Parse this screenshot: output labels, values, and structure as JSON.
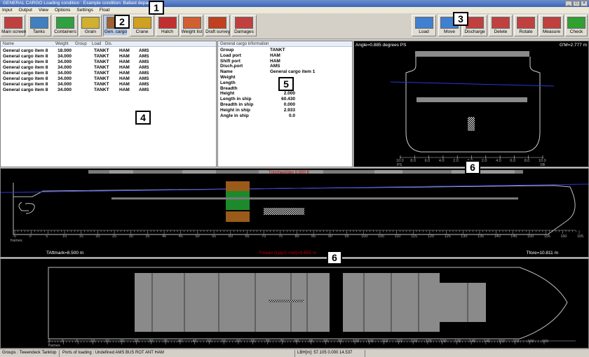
{
  "window": {
    "title": "GENERAL CARGO  Loading condition : Example condition: Ballast departure"
  },
  "menu": [
    "Input",
    "Output",
    "View",
    "Options",
    "Settings",
    "Float"
  ],
  "toolbar_left": [
    {
      "label": "Main screen",
      "icon": "ship-icon",
      "color": "#c04040"
    },
    {
      "label": "Tanks",
      "icon": "tanks-icon",
      "color": "#4080c0"
    },
    {
      "label": "Containers",
      "icon": "containers-icon",
      "color": "#30a040"
    },
    {
      "label": "Grain",
      "icon": "grain-icon",
      "color": "#d0b030"
    },
    {
      "label": "Gen. cargo",
      "icon": "gen-cargo-icon",
      "color": "#a06030"
    },
    {
      "label": "Crane",
      "icon": "crane-icon",
      "color": "#d0a020"
    },
    {
      "label": "Hatch",
      "icon": "hatch-icon",
      "color": "#c03030"
    },
    {
      "label": "Weight list",
      "icon": "weight-list-icon",
      "color": "#d06030"
    },
    {
      "label": "Draft survey",
      "icon": "draft-survey-icon",
      "color": "#c04020"
    },
    {
      "label": "Damages",
      "icon": "damages-icon",
      "color": "#c04040"
    }
  ],
  "toolbar_right": [
    {
      "label": "Load",
      "icon": "load-icon",
      "color": "#4080d0"
    },
    {
      "label": "Move",
      "icon": "move-icon",
      "color": "#4080d0"
    },
    {
      "label": "Discharge",
      "icon": "discharge-icon",
      "color": "#c04040"
    },
    {
      "label": "Delete",
      "icon": "delete-icon",
      "color": "#c04040"
    },
    {
      "label": "Rotate",
      "icon": "rotate-icon",
      "color": "#c04040"
    },
    {
      "label": "Measure",
      "icon": "measure-icon",
      "color": "#c04040"
    },
    {
      "label": "Check",
      "icon": "check-icon",
      "color": "#30a030"
    }
  ],
  "cargo_list": {
    "headers": [
      "Name",
      "Weight",
      "Group",
      "Load",
      "Dis."
    ],
    "rows": [
      [
        "General cargo item 8",
        "18.000",
        "TANKT",
        "HAM",
        "AMS"
      ],
      [
        "General cargo item 8",
        "34.000",
        "TANKT",
        "HAM",
        "AMS"
      ],
      [
        "General cargo item 8",
        "34.000",
        "TANKT",
        "HAM",
        "AMS"
      ],
      [
        "General cargo item 8",
        "34.000",
        "TANKT",
        "HAM",
        "AMS"
      ],
      [
        "General cargo item 8",
        "34.000",
        "TANKT",
        "HAM",
        "AMS"
      ],
      [
        "General cargo item 8",
        "34.000",
        "TANKT",
        "HAM",
        "AMS"
      ],
      [
        "General cargo item 8",
        "34.000",
        "TANKT",
        "HAM",
        "AMS"
      ],
      [
        "General cargo item 8",
        "34.000",
        "TANKT",
        "HAM",
        "AMS"
      ]
    ]
  },
  "cargo_info": {
    "header": "General cargo information",
    "rows": [
      [
        "Group",
        "TANKT"
      ],
      [
        "Load port",
        "HAM"
      ],
      [
        "Shift port",
        "HAM"
      ],
      [
        "Disch.port",
        "AMS"
      ],
      [
        "Name",
        "General cargo item 1"
      ],
      [
        "Weight",
        ""
      ],
      [
        "Length",
        ""
      ],
      [
        "Breadth",
        ""
      ],
      [
        "Height",
        "2.000"
      ],
      [
        "Length in ship",
        "60.430"
      ],
      [
        "Breadth in ship",
        "0.000"
      ],
      [
        "Height in ship",
        "2.933"
      ],
      [
        "Angle in ship",
        "0.0"
      ]
    ]
  },
  "section_view": {
    "angle": "Angle=0.885 degrees PS",
    "gm": "G'M=2.777 m",
    "scale_labels": [
      "10.0",
      "8.0",
      "6.0",
      "4.0",
      "2.0",
      "0.0",
      "2.0",
      "4.0",
      "6.0",
      "8.0",
      "10.0"
    ],
    "ps": "PS",
    "meters": "meters",
    "sb": "SB"
  },
  "profile_view": {
    "top_label": "Trim/heel/dev 0.000 ft",
    "frames_label": "frames",
    "frame_ticks": [
      "-5",
      "0",
      "5",
      "10",
      "15",
      "20",
      "25",
      "30",
      "35",
      "40",
      "45",
      "50",
      "55",
      "60",
      "65",
      "70",
      "75",
      "80",
      "85",
      "90",
      "95",
      "100",
      "105",
      "110",
      "115",
      "120",
      "125",
      "130",
      "135",
      "140",
      "145",
      "150",
      "155",
      "160",
      "165"
    ],
    "taft": "TAftmark=8.500 m",
    "tmean": "Tmean (Lpp/2 mid)=9.655 m",
    "tfore": "Tfore=10.811 m"
  },
  "plan_view": {
    "frames_label": "frames",
    "frame_ticks": [
      "-5",
      "0",
      "5",
      "10",
      "15",
      "20",
      "25",
      "30",
      "35",
      "40",
      "45",
      "50",
      "55",
      "60",
      "65",
      "70",
      "75",
      "80",
      "85",
      "90",
      "95",
      "100",
      "105",
      "110",
      "115",
      "120",
      "125",
      "130",
      "135",
      "140",
      "145",
      "150",
      "155",
      "160",
      "165"
    ]
  },
  "callouts": [
    "1",
    "2",
    "3",
    "4",
    "5",
    "6",
    "6"
  ],
  "status": {
    "groups": "Groups : Tweendeck Tanktop",
    "ports": "Ports of loading : Undefined AMS BUS ROT ANT HAM",
    "lbh": "LBH[m]: 57.105   0.000   14.537"
  }
}
